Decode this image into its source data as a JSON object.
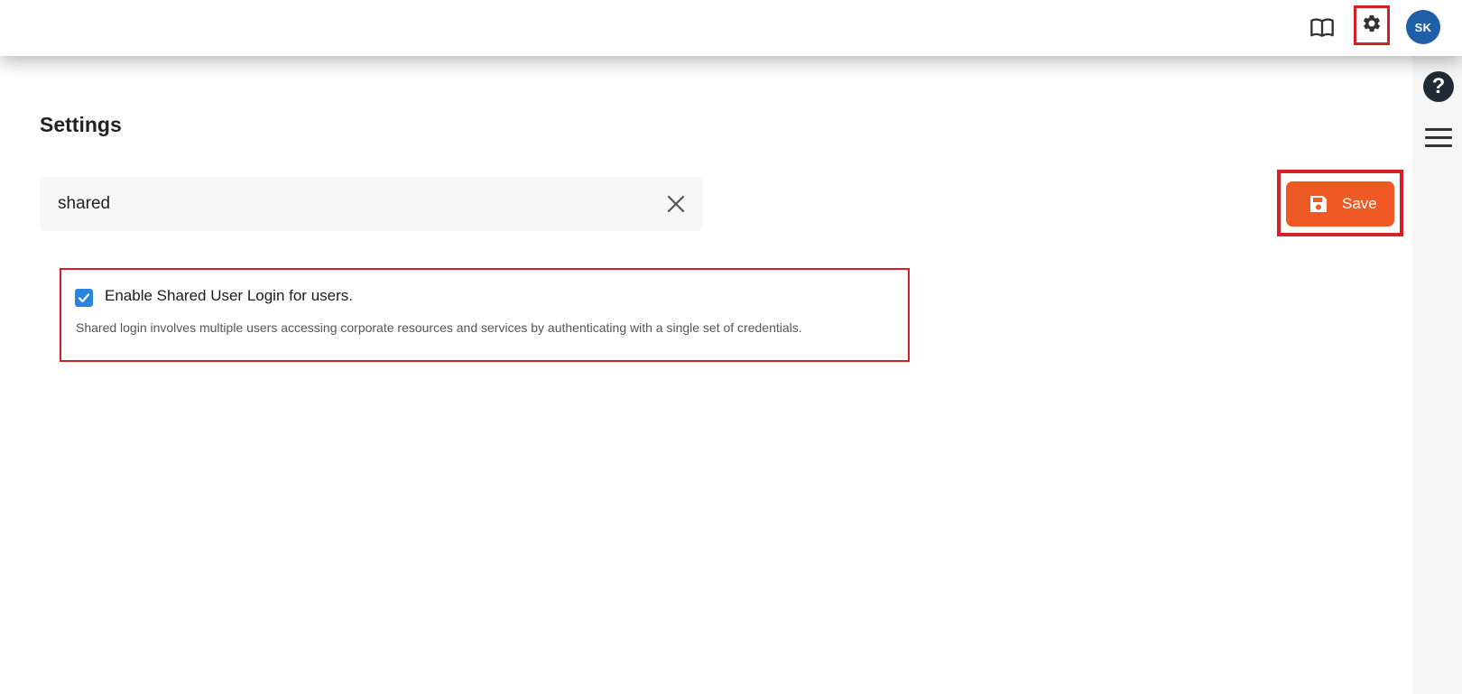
{
  "header": {
    "book_icon": "book-open-icon",
    "settings_icon": "gear-icon",
    "avatar_initials": "SK"
  },
  "rail": {
    "help_icon": "help-icon",
    "help_glyph": "?",
    "menu_icon": "hamburger-menu-icon"
  },
  "page": {
    "title": "Settings"
  },
  "search": {
    "value": "shared",
    "clear_icon": "close-icon"
  },
  "toolbar": {
    "save_label": "Save",
    "save_icon": "floppy-disk-icon"
  },
  "setting": {
    "checked": true,
    "label": "Enable Shared User Login for users.",
    "description": "Shared login involves multiple users accessing corporate resources and services by authenticating with a single set of credentials."
  },
  "colors": {
    "accent": "#ef5a24",
    "highlight": "#d61f26",
    "checkbox": "#2a83de",
    "avatar": "#1f5fa8"
  }
}
